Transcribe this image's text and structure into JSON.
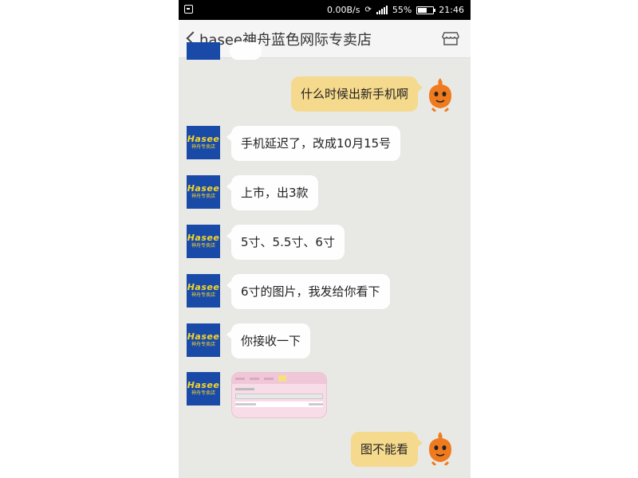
{
  "status_bar": {
    "speed": "0.00B/s",
    "battery": "55%",
    "time": "21:46"
  },
  "header": {
    "title": "hasee神舟蓝色网际专卖店"
  },
  "avatar": {
    "brand": "Hasee",
    "sub": "神舟专卖店"
  },
  "messages": [
    {
      "side": "out",
      "text": "什么时候出新手机啊"
    },
    {
      "side": "in",
      "text": "手机延迟了，改成10月15号"
    },
    {
      "side": "in",
      "text": "上市，出3款"
    },
    {
      "side": "in",
      "text": "5寸、5.5寸、6寸"
    },
    {
      "side": "in",
      "text": "6寸的图片，我发给你看下"
    },
    {
      "side": "in",
      "text": "你接收一下"
    },
    {
      "side": "in",
      "type": "image"
    },
    {
      "side": "out",
      "text": "图不能看"
    }
  ],
  "colors": {
    "chat_bg": "#e8e9e5",
    "outgoing_bubble": "#f5d98c",
    "incoming_bubble": "#fefefe",
    "avatar_bg": "#1a4aa8",
    "avatar_text": "#f4d62a"
  }
}
